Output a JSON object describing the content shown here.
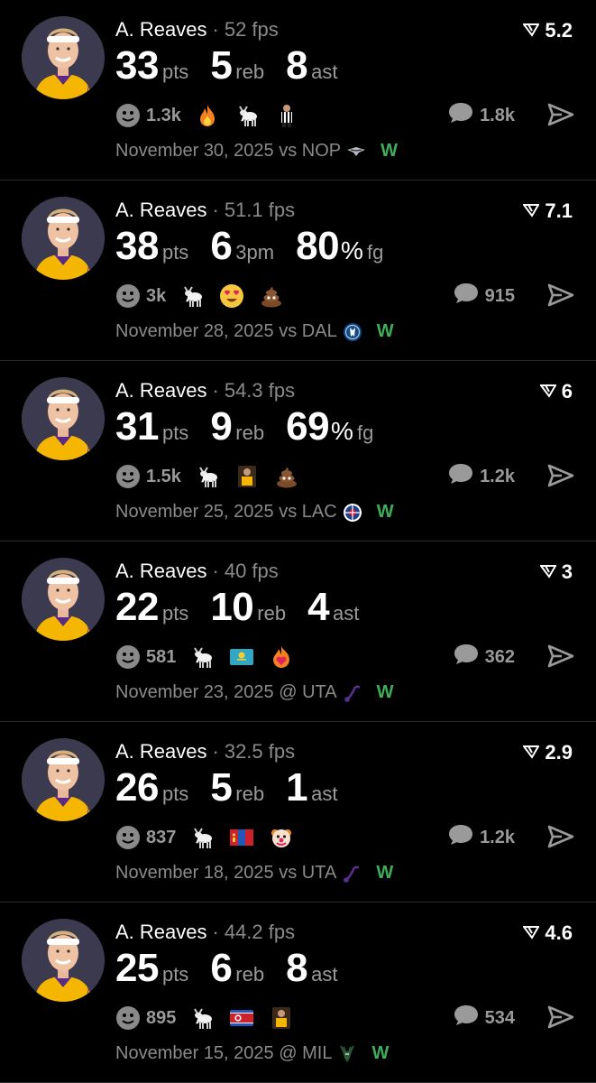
{
  "colors": {
    "background": "#000000",
    "muted": "#8a8a8a",
    "win": "#3fae5a",
    "divider": "#2a2a2a",
    "jersey": "#f4b600"
  },
  "cards": [
    {
      "player": "A. Reaves",
      "fps": "52 fps",
      "rating": "5.2",
      "stats": [
        {
          "value": "33",
          "label": "pts"
        },
        {
          "value": "5",
          "label": "reb"
        },
        {
          "value": "8",
          "label": "ast"
        }
      ],
      "reactions": "1.3k",
      "emojis": [
        "fire",
        "goat",
        "referee"
      ],
      "comments": "1.8k",
      "date": "November 30, 2025",
      "venue": "vs",
      "opponent": "NOP",
      "opponent_logo": "pelicans-logo",
      "result": "W"
    },
    {
      "player": "A. Reaves",
      "fps": "51.1 fps",
      "rating": "7.1",
      "stats": [
        {
          "value": "38",
          "label": "pts"
        },
        {
          "value": "6",
          "label": "3pm"
        },
        {
          "value": "80",
          "pct": "%",
          "label": "fg"
        }
      ],
      "reactions": "3k",
      "emojis": [
        "goat",
        "heart-eyes",
        "poop"
      ],
      "comments": "915",
      "date": "November 28, 2025",
      "venue": "vs",
      "opponent": "DAL",
      "opponent_logo": "mavericks-logo",
      "result": "W"
    },
    {
      "player": "A. Reaves",
      "fps": "54.3 fps",
      "rating": "6",
      "stats": [
        {
          "value": "31",
          "label": "pts"
        },
        {
          "value": "9",
          "label": "reb"
        },
        {
          "value": "69",
          "pct": "%",
          "label": "fg"
        }
      ],
      "reactions": "1.5k",
      "emojis": [
        "goat",
        "player-photo",
        "poop"
      ],
      "comments": "1.2k",
      "date": "November 25, 2025",
      "venue": "vs",
      "opponent": "LAC",
      "opponent_logo": "clippers-logo",
      "result": "W"
    },
    {
      "player": "A. Reaves",
      "fps": "40 fps",
      "rating": "3",
      "stats": [
        {
          "value": "22",
          "label": "pts"
        },
        {
          "value": "10",
          "label": "reb"
        },
        {
          "value": "4",
          "label": "ast"
        }
      ],
      "reactions": "581",
      "emojis": [
        "goat",
        "kazakhstan-flag",
        "fire-heart"
      ],
      "comments": "362",
      "date": "November 23, 2025",
      "venue": "@",
      "opponent": "UTA",
      "opponent_logo": "jazz-logo",
      "result": "W"
    },
    {
      "player": "A. Reaves",
      "fps": "32.5 fps",
      "rating": "2.9",
      "stats": [
        {
          "value": "26",
          "label": "pts"
        },
        {
          "value": "5",
          "label": "reb"
        },
        {
          "value": "1",
          "label": "ast"
        }
      ],
      "reactions": "837",
      "emojis": [
        "goat",
        "mongolia-flag",
        "clown"
      ],
      "comments": "1.2k",
      "date": "November 18, 2025",
      "venue": "vs",
      "opponent": "UTA",
      "opponent_logo": "jazz-logo",
      "result": "W"
    },
    {
      "player": "A. Reaves",
      "fps": "44.2 fps",
      "rating": "4.6",
      "stats": [
        {
          "value": "25",
          "label": "pts"
        },
        {
          "value": "6",
          "label": "reb"
        },
        {
          "value": "8",
          "label": "ast"
        }
      ],
      "reactions": "895",
      "emojis": [
        "goat",
        "north-korea-flag",
        "player-photo"
      ],
      "comments": "534",
      "date": "November 15, 2025",
      "venue": "@",
      "opponent": "MIL",
      "opponent_logo": "bucks-logo",
      "result": "W"
    }
  ]
}
